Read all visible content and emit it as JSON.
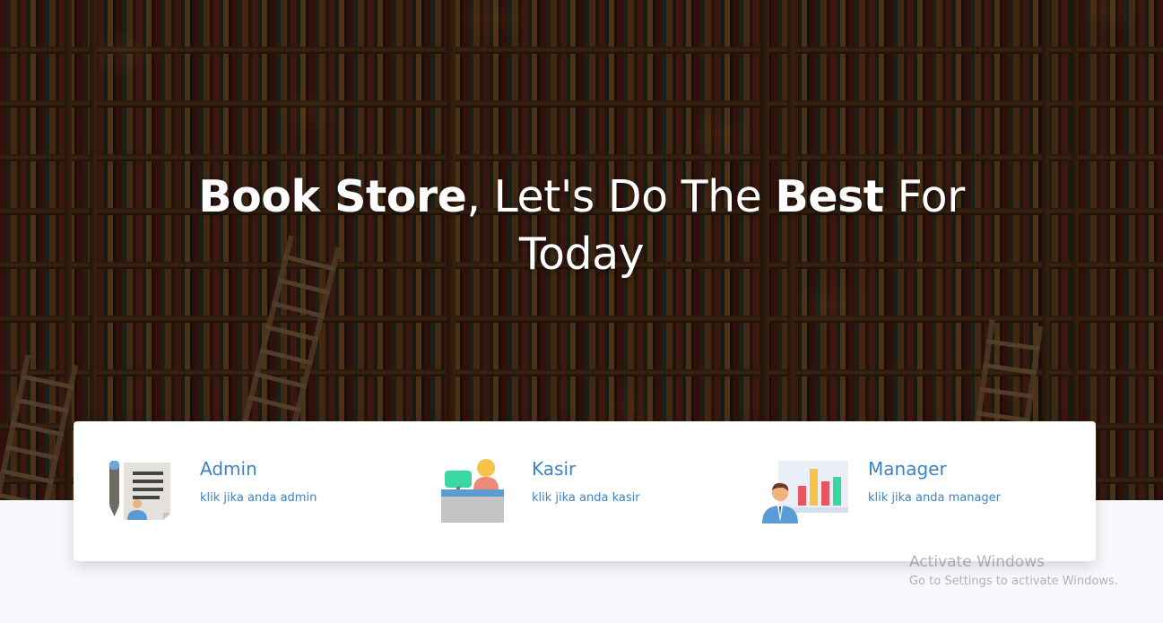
{
  "hero": {
    "title_bold_1": "Book Store",
    "title_mid": ", Let's Do The ",
    "title_bold_2": "Best",
    "title_end": " For",
    "title_line2": "Today"
  },
  "roles": [
    {
      "label": "Admin",
      "description": "klik jika anda admin",
      "icon": "admin-document-icon"
    },
    {
      "label": "Kasir",
      "description": "klik jika anda kasir",
      "icon": "cashier-desk-icon"
    },
    {
      "label": "Manager",
      "description": "klik jika anda manager",
      "icon": "manager-chart-icon"
    }
  ],
  "watermark": {
    "title": "Activate Windows",
    "subtitle": "Go to Settings to activate Windows."
  },
  "colors": {
    "accent": "#3c83c5",
    "page_background": "#f7f9fc",
    "card_background": "#ffffff"
  }
}
